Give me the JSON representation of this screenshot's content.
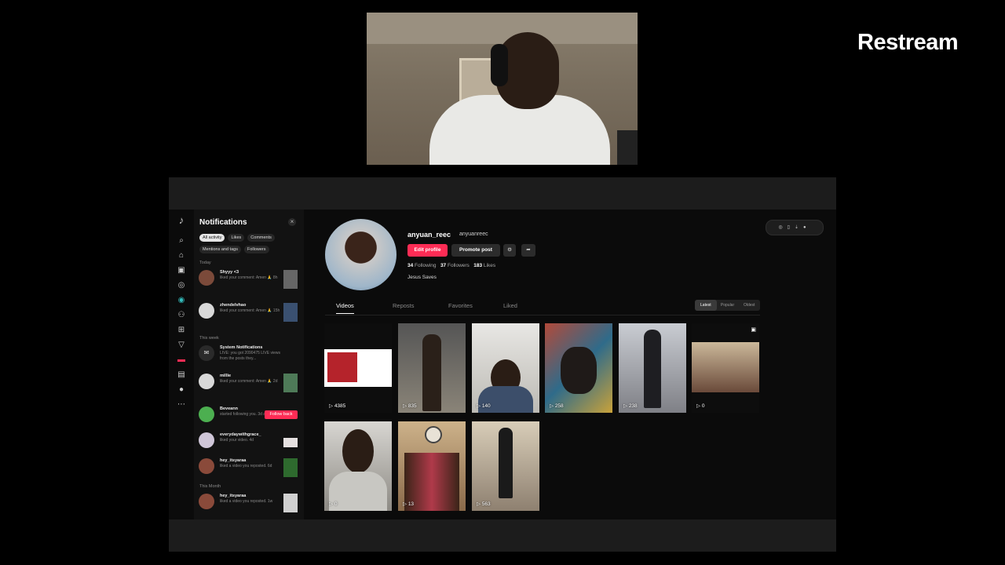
{
  "brand": "Restream",
  "notifications": {
    "title": "Notifications",
    "filters": [
      "All activity",
      "Likes",
      "Comments"
    ],
    "filters2": [
      "Mentions and tags",
      "Followers"
    ],
    "sections": {
      "today": "Today",
      "this_week": "This week",
      "this_month": "This Month"
    },
    "items": [
      {
        "name": "Shyyy <3",
        "desc": "liked your comment: Amen 🙏 8h",
        "action": "thumb"
      },
      {
        "name": "zhendelvhao",
        "desc": "liked your comment: Amen 🙏 15h",
        "action": "thumb"
      },
      {
        "name": "System Notifications",
        "desc": "LIVE: you got 2090475 LIVE views from the posts they...",
        "action": "none"
      },
      {
        "name": "millie",
        "desc": "liked your comment: Amen 🙏 2d",
        "action": "thumb"
      },
      {
        "name": "Beveann",
        "desc": "started following you. 3d ago",
        "action": "follow",
        "action_label": "Follow back"
      },
      {
        "name": "everydaywithgrace_",
        "desc": "liked your video. 4d",
        "action": "thumb"
      },
      {
        "name": "hey_itsyaraa",
        "desc": "liked a video you reposted. 6d",
        "action": "thumb"
      },
      {
        "name": "hey_itsyaraa",
        "desc": "liked a video you reposted. 1w",
        "action": "thumb"
      }
    ]
  },
  "profile": {
    "username": "anyuan_reec",
    "handle": "anyuanreec",
    "edit_label": "Edit profile",
    "promote_label": "Promote post",
    "following_count": "34",
    "following_label": "Following",
    "followers_count": "37",
    "followers_label": "Followers",
    "likes_count": "183",
    "likes_label": "Likes",
    "bio": "Jesus Saves",
    "tabs": [
      "Videos",
      "Reposts",
      "Favorites",
      "Liked"
    ],
    "sort": [
      "Latest",
      "Popular",
      "Oldest"
    ]
  },
  "videos": [
    {
      "views": "4385",
      "color": "#ffffff"
    },
    {
      "views": "835",
      "color": "#7a7468"
    },
    {
      "views": "140",
      "color": "#d9d7d2"
    },
    {
      "views": "258",
      "color": "#6a5b46"
    },
    {
      "views": "238",
      "color": "#8e9097"
    },
    {
      "views": "0",
      "color": "#c9b79a"
    },
    {
      "views": "0",
      "color": "#9c8f80"
    },
    {
      "views": "13",
      "color": "#c8a67a"
    },
    {
      "views": "563",
      "color": "#a49680"
    }
  ],
  "colors": {
    "accent": "#fe2c55"
  }
}
